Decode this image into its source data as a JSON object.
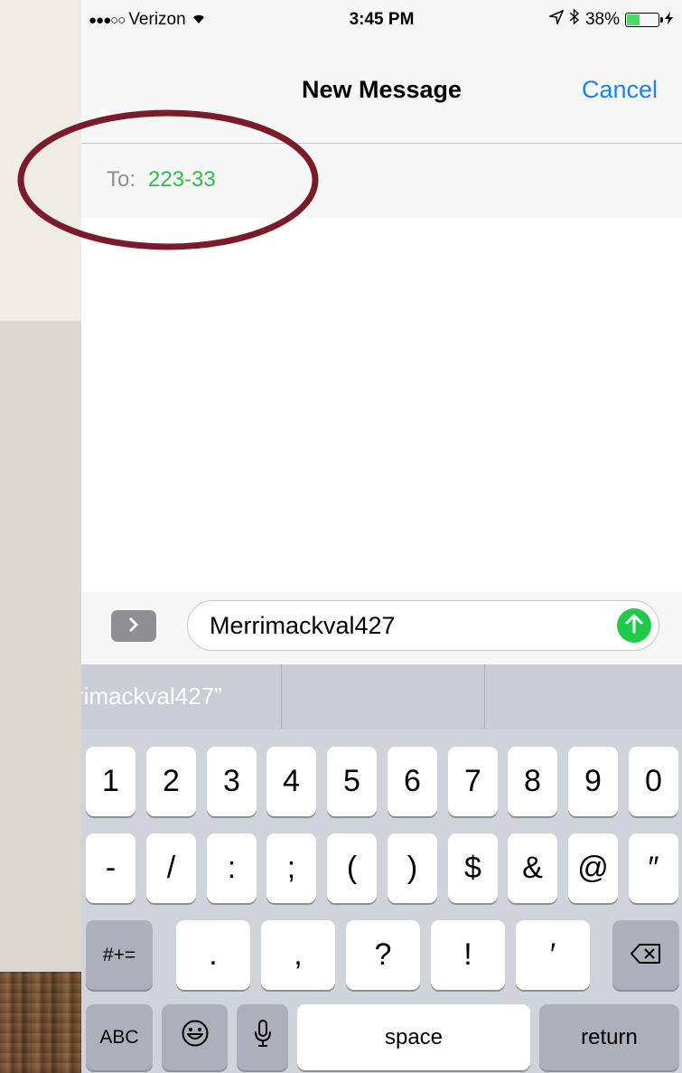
{
  "status_bar": {
    "carrier": "Verizon",
    "signal_dots": "●●●○○",
    "time": "3:45 PM",
    "battery_percent": "38%",
    "battery_level": 0.38
  },
  "nav": {
    "title": "New Message",
    "cancel_label": "Cancel"
  },
  "recipient": {
    "label": "To:",
    "value": "223-33"
  },
  "compose": {
    "message_text": "Merrimackval427"
  },
  "predictive": {
    "suggestion": "rimackval427”"
  },
  "keyboard": {
    "row1": [
      "1",
      "2",
      "3",
      "4",
      "5",
      "6",
      "7",
      "8",
      "9",
      "0"
    ],
    "row2": [
      "-",
      "/",
      ":",
      ";",
      "(",
      ")",
      "$",
      "&",
      "@",
      "″"
    ],
    "row3": [
      ".",
      ",",
      "?",
      "!",
      "′"
    ],
    "more_symbols": "#+=",
    "abc": "ABC",
    "space": "space",
    "return": "return"
  },
  "colors": {
    "accent_blue": "#1a82fb",
    "recipient_green": "#2dbe45",
    "send_green": "#1ec94b",
    "annotation_red": "#7a1a2a"
  }
}
